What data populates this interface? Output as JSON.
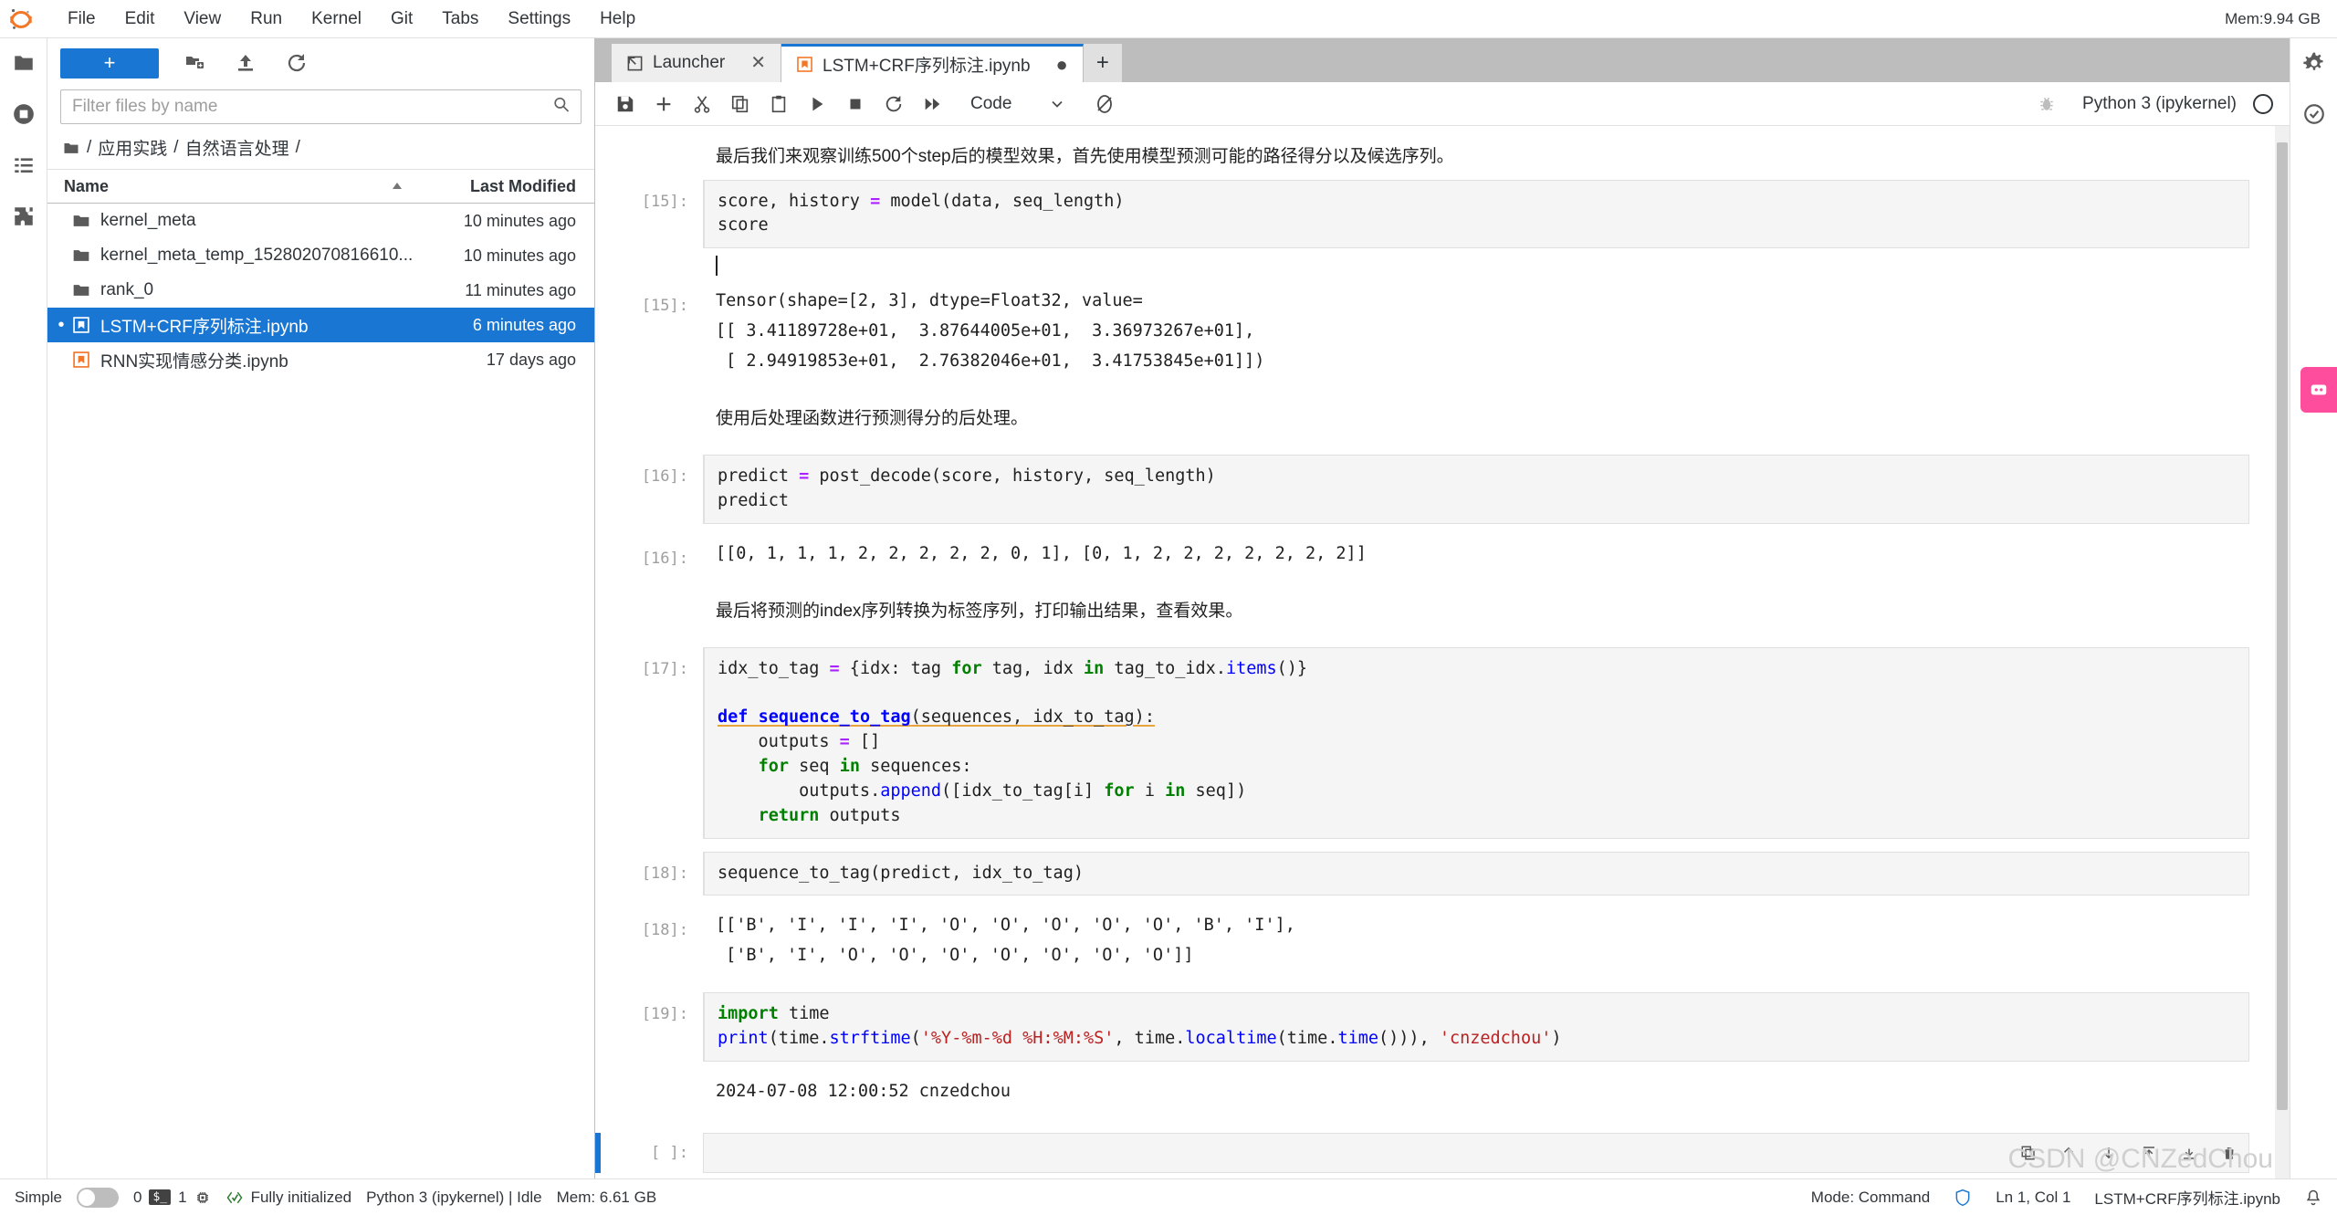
{
  "menubar": {
    "logo_icon": "jupyter-logo-icon",
    "items": [
      "File",
      "Edit",
      "View",
      "Run",
      "Kernel",
      "Git",
      "Tabs",
      "Settings",
      "Help"
    ],
    "mem_label": "Mem:9.94 GB"
  },
  "activitybar": {
    "items": [
      {
        "name": "file-browser-icon",
        "glyph": "folder"
      },
      {
        "name": "running-terminals-icon",
        "glyph": "stop"
      },
      {
        "name": "table-of-contents-icon",
        "glyph": "list"
      },
      {
        "name": "extension-manager-icon",
        "glyph": "puzzle"
      }
    ]
  },
  "filebrowser": {
    "new_launcher_label": "+",
    "toolbar_icons": [
      "new-folder-icon",
      "upload-icon",
      "refresh-icon"
    ],
    "filter_placeholder": "Filter files by name",
    "filter_value": "",
    "search_icon": "search-icon",
    "breadcrumb": [
      "/",
      "应用实践",
      "/",
      "自然语言处理",
      "/"
    ],
    "columns": {
      "name": "Name",
      "last_modified": "Last Modified"
    },
    "sort_indicator": "ascending",
    "rows": [
      {
        "name": "kernel_meta",
        "modified": "10 minutes ago",
        "type": "folder",
        "selected": false,
        "running": false
      },
      {
        "name": "kernel_meta_temp_152802070816610...",
        "modified": "10 minutes ago",
        "type": "folder",
        "selected": false,
        "running": false
      },
      {
        "name": "rank_0",
        "modified": "11 minutes ago",
        "type": "folder",
        "selected": false,
        "running": false
      },
      {
        "name": "LSTM+CRF序列标注.ipynb",
        "modified": "6 minutes ago",
        "type": "notebook",
        "selected": true,
        "running": true
      },
      {
        "name": "RNN实现情感分类.ipynb",
        "modified": "17 days ago",
        "type": "notebook",
        "selected": false,
        "running": false
      }
    ]
  },
  "tabbar": {
    "tabs": [
      {
        "label": "Launcher",
        "icon": "launcher-icon",
        "current": false,
        "close_glyph": "✕",
        "dirty": false
      },
      {
        "label": "LSTM+CRF序列标注.ipynb",
        "icon": "notebook-icon",
        "current": true,
        "close_glyph": "●",
        "dirty": true
      }
    ],
    "add_tab_label": "+"
  },
  "notebook_toolbar": {
    "icons": [
      "save-icon",
      "insert-cell-icon",
      "cut-icon",
      "copy-icon",
      "paste-icon",
      "run-icon",
      "stop-icon",
      "restart-icon",
      "restart-run-all-icon"
    ],
    "celltype_value": "Code",
    "celltype_chevron": "chevron-down-icon",
    "sync_icon": "sync-icon",
    "debugger_icon": "bug-icon",
    "kernel_name": "Python 3 (ipykernel)",
    "kernel_status_icon": "kernel-idle-circle-icon"
  },
  "notebook": {
    "cells": [
      {
        "kind": "markdown",
        "text": "最后我们来观察训练500个step后的模型效果，首先使用模型预测可能的路径得分以及候选序列。"
      },
      {
        "kind": "code",
        "prompt": "[15]:",
        "lines": [
          "score, history = model(data, seq_length)",
          "score"
        ]
      },
      {
        "kind": "output",
        "prompt": "[15]:",
        "lines": [
          "Tensor(shape=[2, 3], dtype=Float32, value=",
          "[[ 3.41189728e+01,  3.87644005e+01,  3.36973267e+01],",
          " [ 2.94919853e+01,  2.76382046e+01,  3.41753845e+01]])"
        ]
      },
      {
        "kind": "markdown",
        "text": "使用后处理函数进行预测得分的后处理。"
      },
      {
        "kind": "code",
        "prompt": "[16]:",
        "lines": [
          "predict = post_decode(score, history, seq_length)",
          "predict"
        ]
      },
      {
        "kind": "output",
        "prompt": "[16]:",
        "lines": [
          "[[0, 1, 1, 1, 2, 2, 2, 2, 2, 0, 1], [0, 1, 2, 2, 2, 2, 2, 2, 2]]"
        ]
      },
      {
        "kind": "markdown",
        "text": "最后将预测的index序列转换为标签序列，打印输出结果，查看效果。"
      },
      {
        "kind": "code",
        "prompt": "[17]:",
        "lines": [
          "idx_to_tag = {idx: tag for tag, idx in tag_to_idx.items()}",
          "",
          "def sequence_to_tag(sequences, idx_to_tag):",
          "    outputs = []",
          "    for seq in sequences:",
          "        outputs.append([idx_to_tag[i] for i in seq])",
          "    return outputs"
        ]
      },
      {
        "kind": "code",
        "prompt": "[18]:",
        "lines": [
          "sequence_to_tag(predict, idx_to_tag)"
        ]
      },
      {
        "kind": "output",
        "prompt": "[18]:",
        "lines": [
          "[['B', 'I', 'I', 'I', 'O', 'O', 'O', 'O', 'O', 'B', 'I'],",
          " ['B', 'I', 'O', 'O', 'O', 'O', 'O', 'O', 'O']]"
        ]
      },
      {
        "kind": "code",
        "prompt": "[19]:",
        "lines": [
          "import time",
          "print(time.strftime('%Y-%m-%d %H:%M:%S', time.localtime(time.time())), 'cnzedchou')"
        ]
      },
      {
        "kind": "stream",
        "prompt": "",
        "lines": [
          "2024-07-08 12:00:52 cnzedchou"
        ]
      },
      {
        "kind": "empty",
        "prompt": "[ ]:",
        "cell_toolbar_icons": [
          "duplicate-icon",
          "move-up-icon",
          "move-down-icon",
          "insert-above-icon",
          "insert-below-icon",
          "delete-icon"
        ]
      }
    ]
  },
  "right_bar": {
    "icons": [
      "settings-gear-icon",
      "property-inspector-icon"
    ],
    "pink_button_icon": "assistant-icon"
  },
  "statusbar": {
    "simple_label": "Simple",
    "simple_on": false,
    "terminals_count": "0",
    "terminal_badge": "$_",
    "kernels_count": "1",
    "kernel_glyph_icon": "cpu-icon",
    "init_status": "Fully initialized",
    "init_icon": "code-check-icon",
    "kernel_status": "Python 3 (ipykernel) | Idle",
    "memory": "Mem: 6.61 GB",
    "mode": "Mode: Command",
    "notifications_icon": "bell-icon",
    "shield_icon": "shield-icon",
    "cursor_position": "Ln 1, Col 1",
    "filename": "LSTM+CRF序列标注.ipynb"
  },
  "watermark": {
    "text": "CSDN @CNZedChou"
  },
  "colors": {
    "accent": "#1976d2",
    "tabbar_bg": "#bdbdbd",
    "cell_bg": "#f5f5f5",
    "pink": "#ff4d9e"
  }
}
